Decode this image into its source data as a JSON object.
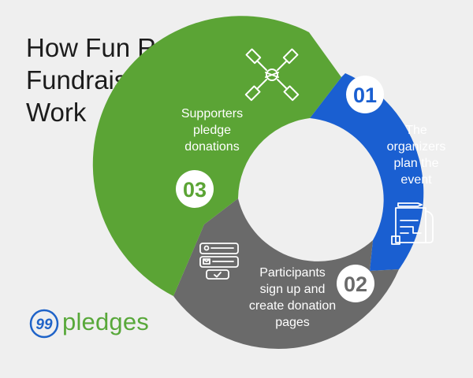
{
  "title": {
    "lines": [
      "How Fun Run",
      "Fundraisers",
      "Work"
    ]
  },
  "steps": [
    {
      "number": "01",
      "lines": [
        "The",
        "organizers",
        "plan the",
        "event"
      ],
      "color": "#1a5fd1",
      "icon": "blueprint-icon"
    },
    {
      "number": "02",
      "lines": [
        "Participants",
        "sign up and",
        "create donation",
        "pages"
      ],
      "color": "#6a6a6a",
      "icon": "signup-form-icon"
    },
    {
      "number": "03",
      "lines": [
        "Supporters",
        "pledge",
        "donations"
      ],
      "color": "#5ba435",
      "icon": "team-hands-icon"
    }
  ],
  "logo": {
    "mark": "99",
    "text": "pledges",
    "color_blue": "#1f63c8",
    "color_green": "#58a83a"
  }
}
